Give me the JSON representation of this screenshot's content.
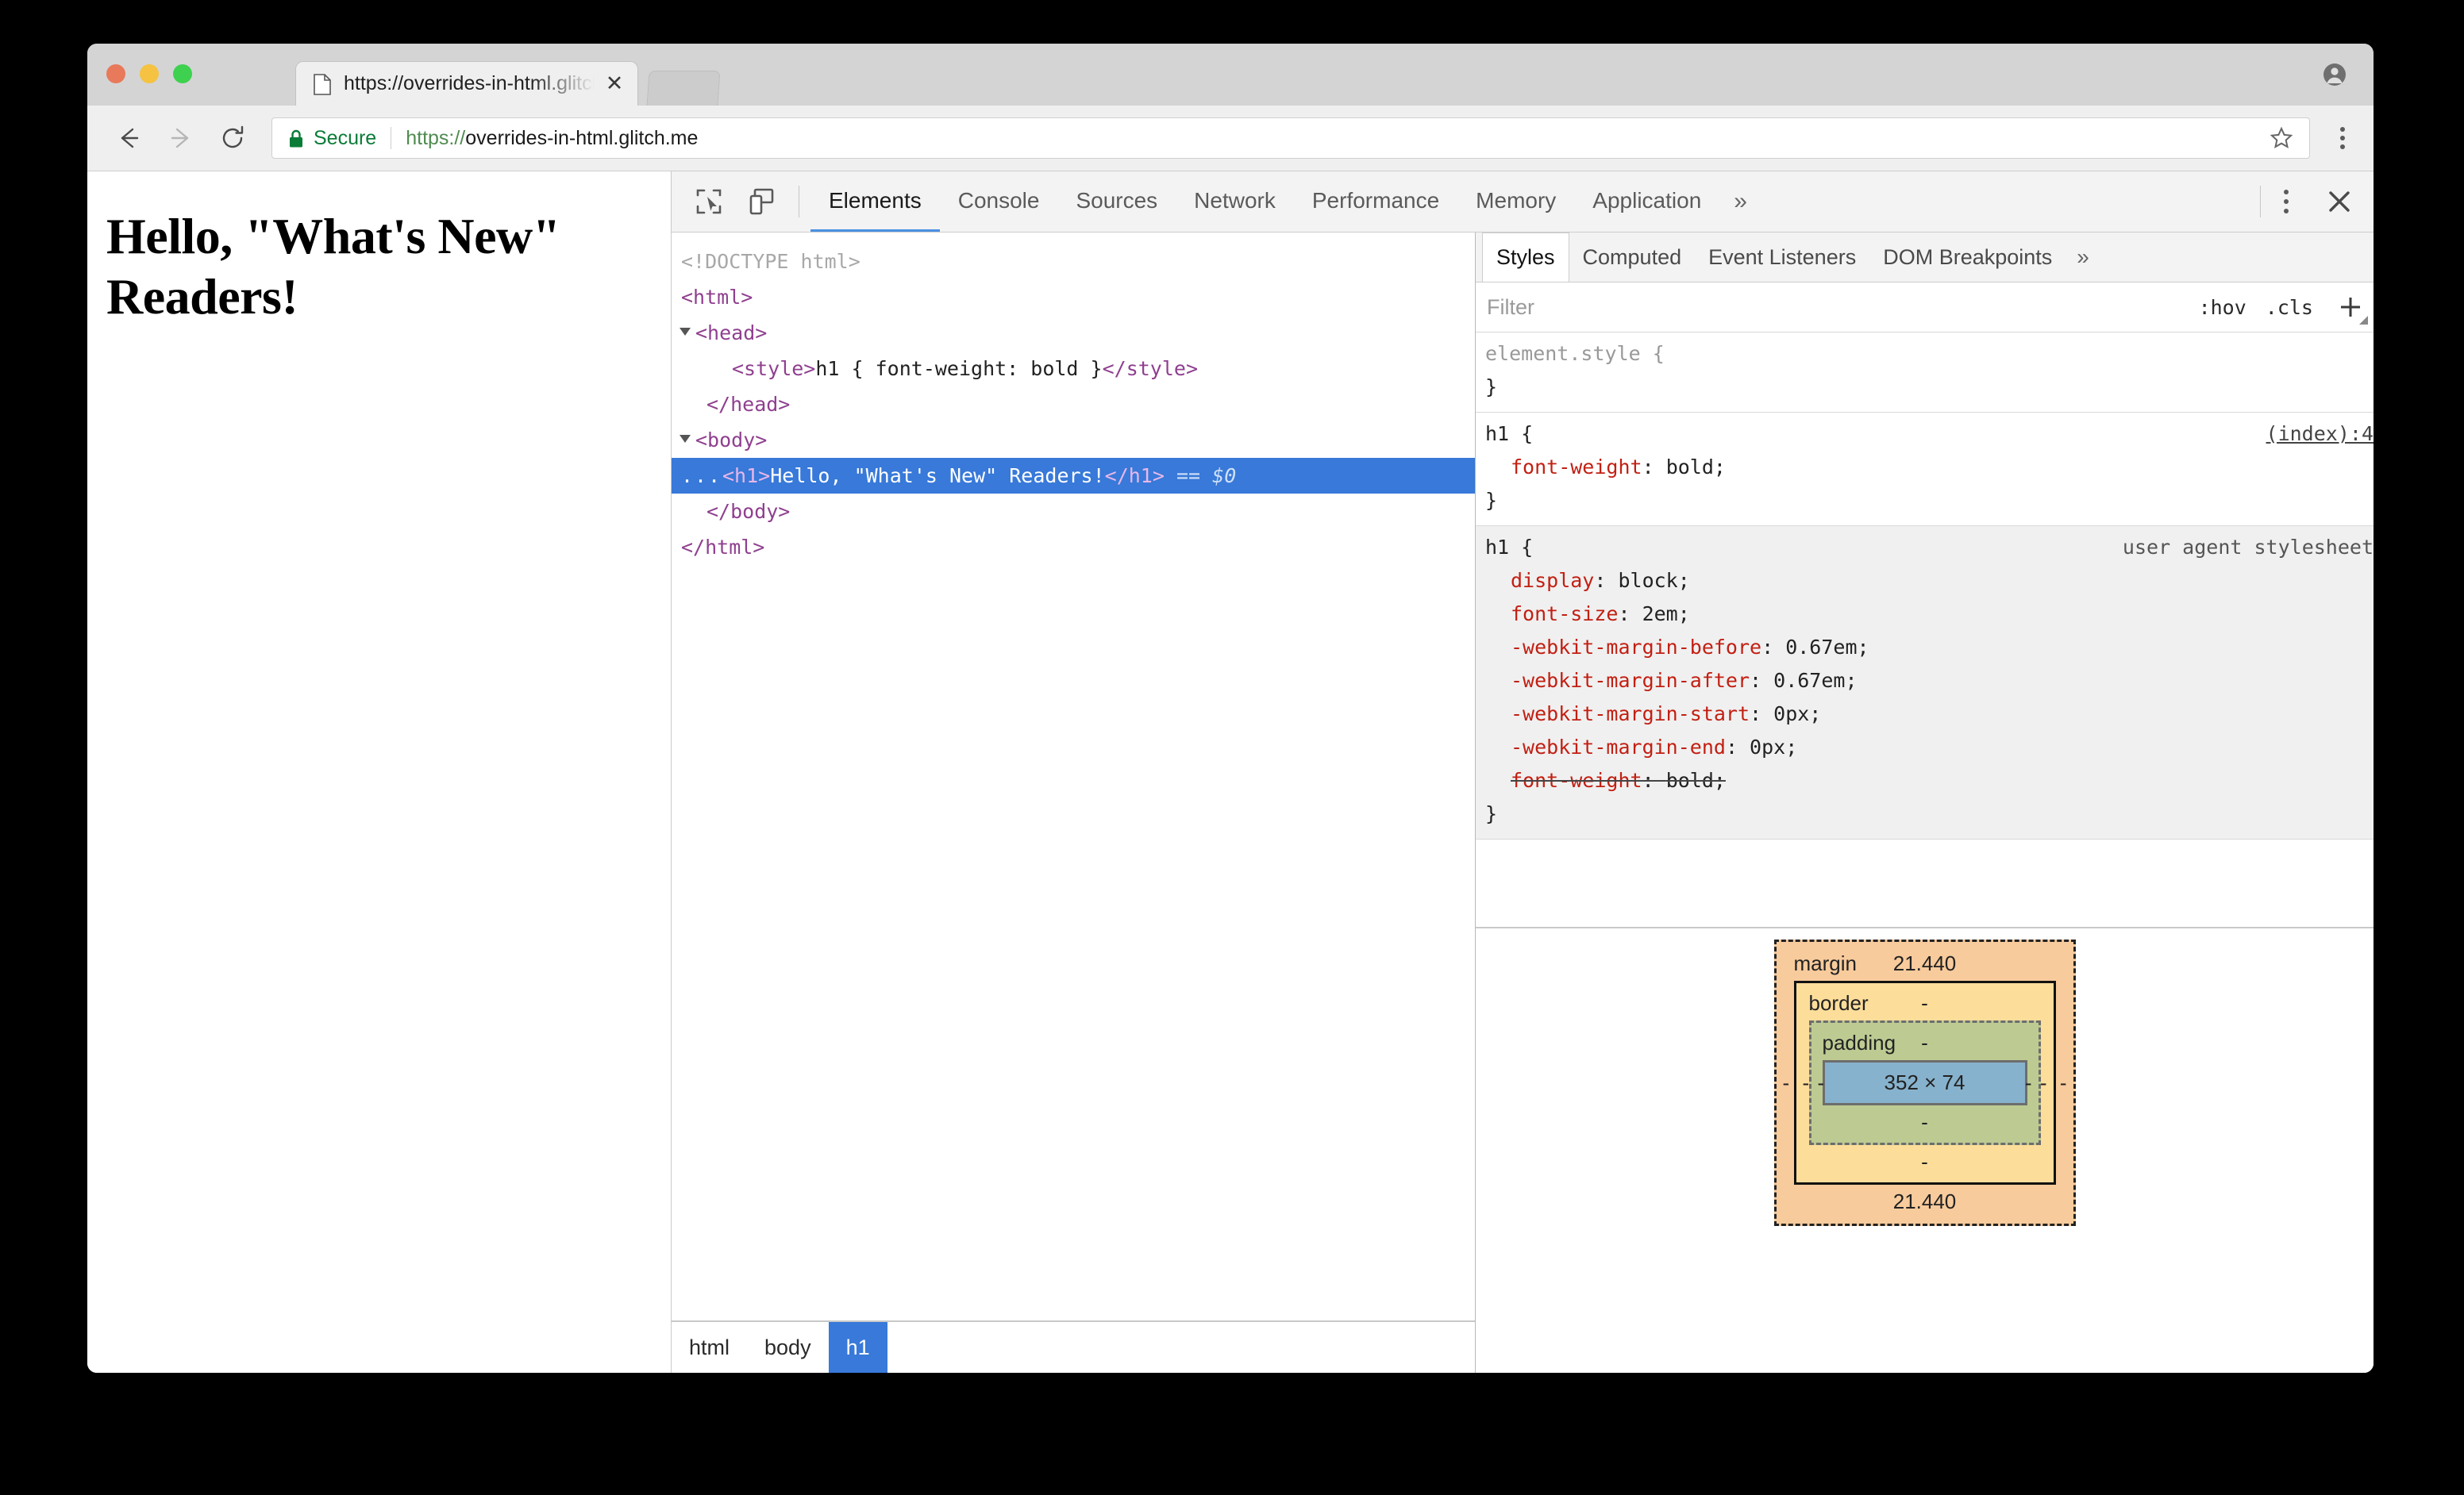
{
  "browser": {
    "tab": {
      "title": "https://overrides-in-html.glitch.me",
      "favicon_icon": "page-icon",
      "close_icon": "close-icon"
    },
    "toolbar": {
      "back_icon": "back-arrow-icon",
      "forward_icon": "forward-arrow-icon",
      "reload_icon": "reload-icon",
      "lock_icon": "lock-icon",
      "secure_label": "Secure",
      "url_scheme": "https://",
      "url_rest": "overrides-in-html.glitch.me",
      "star_icon": "star-icon",
      "menu_icon": "chrome-menu-icon"
    },
    "profile_icon": "profile-avatar-icon"
  },
  "page": {
    "heading": "Hello, \"What's New\" Readers!"
  },
  "devtools": {
    "inspect_icon": "inspect-element-icon",
    "device_icon": "device-toolbar-icon",
    "tabs": [
      {
        "label": "Elements",
        "active": true
      },
      {
        "label": "Console",
        "active": false
      },
      {
        "label": "Sources",
        "active": false
      },
      {
        "label": "Network",
        "active": false
      },
      {
        "label": "Performance",
        "active": false
      },
      {
        "label": "Memory",
        "active": false
      },
      {
        "label": "Application",
        "active": false
      }
    ],
    "overflow_icon": "chevron-double-right-icon",
    "more_icon": "more-vertical-icon",
    "close_icon": "close-icon",
    "dom": {
      "rows": [
        {
          "text": "<!DOCTYPE html>"
        },
        {
          "text": "<html>"
        },
        {
          "text": "<head>"
        },
        {
          "text": "<style>h1 { font-weight: bold }</style>"
        },
        {
          "text": "</head>"
        },
        {
          "text": "<body>"
        },
        {
          "text": "<h1>Hello, \"What's New\" Readers!</h1> == $0"
        },
        {
          "text": "</body>"
        },
        {
          "text": "</html>"
        }
      ],
      "style_text": "h1 { font-weight: bold }",
      "selected_text": "Hello, \"What's New\" Readers!",
      "selected_eq": "==",
      "selected_dollar": "$0",
      "ellipsis": "..."
    },
    "breadcrumb": [
      {
        "label": "html",
        "active": false
      },
      {
        "label": "body",
        "active": false
      },
      {
        "label": "h1",
        "active": true
      }
    ],
    "styles": {
      "tabs": [
        {
          "label": "Styles",
          "active": true
        },
        {
          "label": "Computed",
          "active": false
        },
        {
          "label": "Event Listeners",
          "active": false
        },
        {
          "label": "DOM Breakpoints",
          "active": false
        }
      ],
      "overflow_icon": "chevron-double-right-icon",
      "filter_placeholder": "Filter",
      "hov_label": ":hov",
      "cls_label": ".cls",
      "plus_icon": "plus-icon",
      "rules": [
        {
          "selector": "element.style",
          "origin": "",
          "declarations": []
        },
        {
          "selector": "h1",
          "origin": "(index):4",
          "origin_is_link": true,
          "declarations": [
            {
              "prop": "font-weight",
              "value": "bold",
              "overridden": false
            }
          ]
        },
        {
          "selector": "h1",
          "origin": "user agent stylesheet",
          "origin_is_link": false,
          "user_agent": true,
          "declarations": [
            {
              "prop": "display",
              "value": "block",
              "overridden": false
            },
            {
              "prop": "font-size",
              "value": "2em",
              "overridden": false
            },
            {
              "prop": "-webkit-margin-before",
              "value": "0.67em",
              "overridden": false
            },
            {
              "prop": "-webkit-margin-after",
              "value": "0.67em",
              "overridden": false
            },
            {
              "prop": "-webkit-margin-start",
              "value": "0px",
              "overridden": false
            },
            {
              "prop": "-webkit-margin-end",
              "value": "0px",
              "overridden": false
            },
            {
              "prop": "font-weight",
              "value": "bold",
              "overridden": true
            }
          ]
        }
      ]
    },
    "box_model": {
      "margin_label": "margin",
      "margin_top": "21.440",
      "margin_bottom": "21.440",
      "margin_left": "-",
      "margin_right": "-",
      "border_label": "border",
      "border_top": "-",
      "border_bottom": "-",
      "border_left": "-",
      "border_right": "-",
      "padding_label": "padding",
      "padding_top": "-",
      "padding_bottom": "-",
      "padding_left": "-",
      "padding_right": "-",
      "content_size": "352 × 74"
    }
  },
  "colors": {
    "selection_blue": "#3879d9",
    "secure_green": "#0b7c38",
    "property_red": "#c21f12",
    "tag_purple": "#8f3f8f",
    "margin_orange": "#f8cb9c",
    "border_yellow": "#fcdd9a",
    "padding_green": "#bdcb93",
    "content_blue": "#87b2cd"
  }
}
